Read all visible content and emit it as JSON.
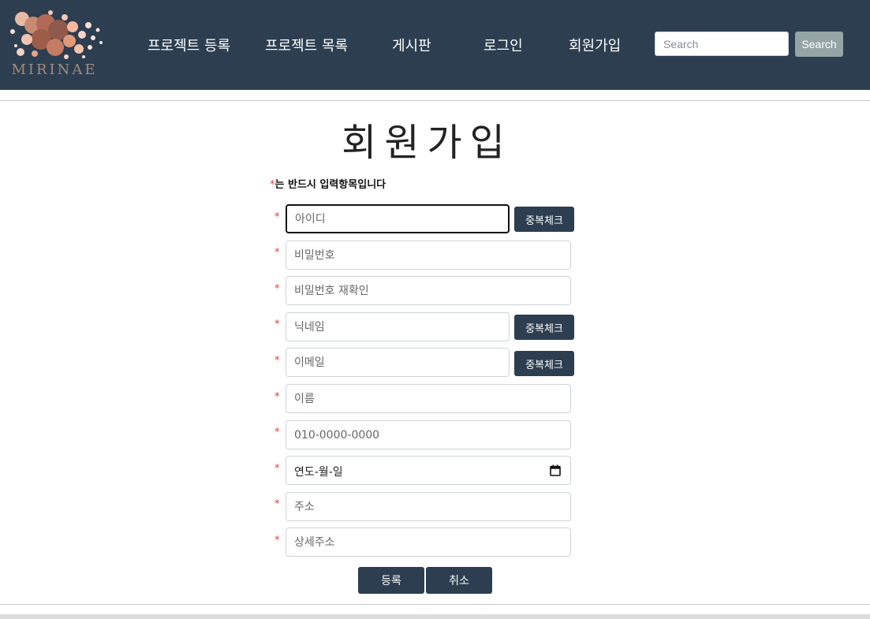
{
  "nav": {
    "logo_text": "MIRINAE",
    "items": [
      "프로젝트 등록",
      "프로젝트 목록",
      "게시판",
      "로그인",
      "회원가입"
    ],
    "search_placeholder": "Search",
    "search_button": "Search"
  },
  "form": {
    "title": "회원가입",
    "required_star": "*",
    "required_note": "는 반드시  입력항목입니다",
    "fields": [
      {
        "placeholder": "아이디",
        "button": "중복체크"
      },
      {
        "placeholder": "비밀번호"
      },
      {
        "placeholder": "비밀번호 재확인"
      },
      {
        "placeholder": "닉네임",
        "button": "중복체크"
      },
      {
        "placeholder": "이메일",
        "button": "중복체크"
      },
      {
        "placeholder": "이름"
      },
      {
        "placeholder": "010-0000-0000"
      },
      {
        "placeholder": "연도-월-일"
      },
      {
        "placeholder": "주소"
      },
      {
        "placeholder": "상세주소"
      }
    ],
    "submit_label": "등록",
    "cancel_label": "취소"
  },
  "colors": {
    "navbar": "#2c3e50",
    "search_button": "#95a5a6",
    "required_star": "#e23b3b",
    "button": "#2c3e50"
  }
}
